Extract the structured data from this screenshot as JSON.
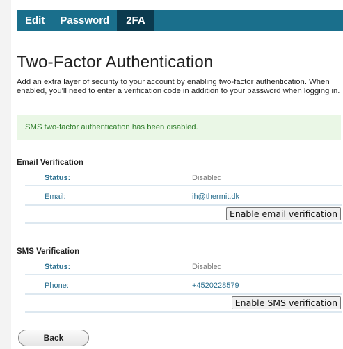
{
  "tabs": [
    {
      "label": "Edit"
    },
    {
      "label": "Password"
    },
    {
      "label": "2FA"
    }
  ],
  "active_tab": "2FA",
  "page": {
    "title": "Two-Factor Authentication",
    "description": "Add an extra layer of security to your account by enabling two-factor authentication. When enabled, you'll need to enter a verification code in addition to your password when logging in."
  },
  "alert": {
    "message": "SMS two-factor authentication has been disabled.",
    "color": "#2e7d2a"
  },
  "email_section": {
    "title": "Email Verification",
    "status_label": "Status:",
    "status_value": "Disabled",
    "field_label": "Email:",
    "field_value": "ih@thermit.dk",
    "button_label": "Enable email verification"
  },
  "sms_section": {
    "title": "SMS Verification",
    "status_label": "Status:",
    "status_value": "Disabled",
    "field_label": "Phone:",
    "field_value": "+4520228579",
    "button_label": "Enable SMS verification"
  },
  "back_button": {
    "label": "Back"
  },
  "colors": {
    "tabbar": "#1a6f8c",
    "tab_active": "#0b3a4e",
    "link": "#2a6f8f",
    "alert_bg": "#eaf7e6"
  }
}
